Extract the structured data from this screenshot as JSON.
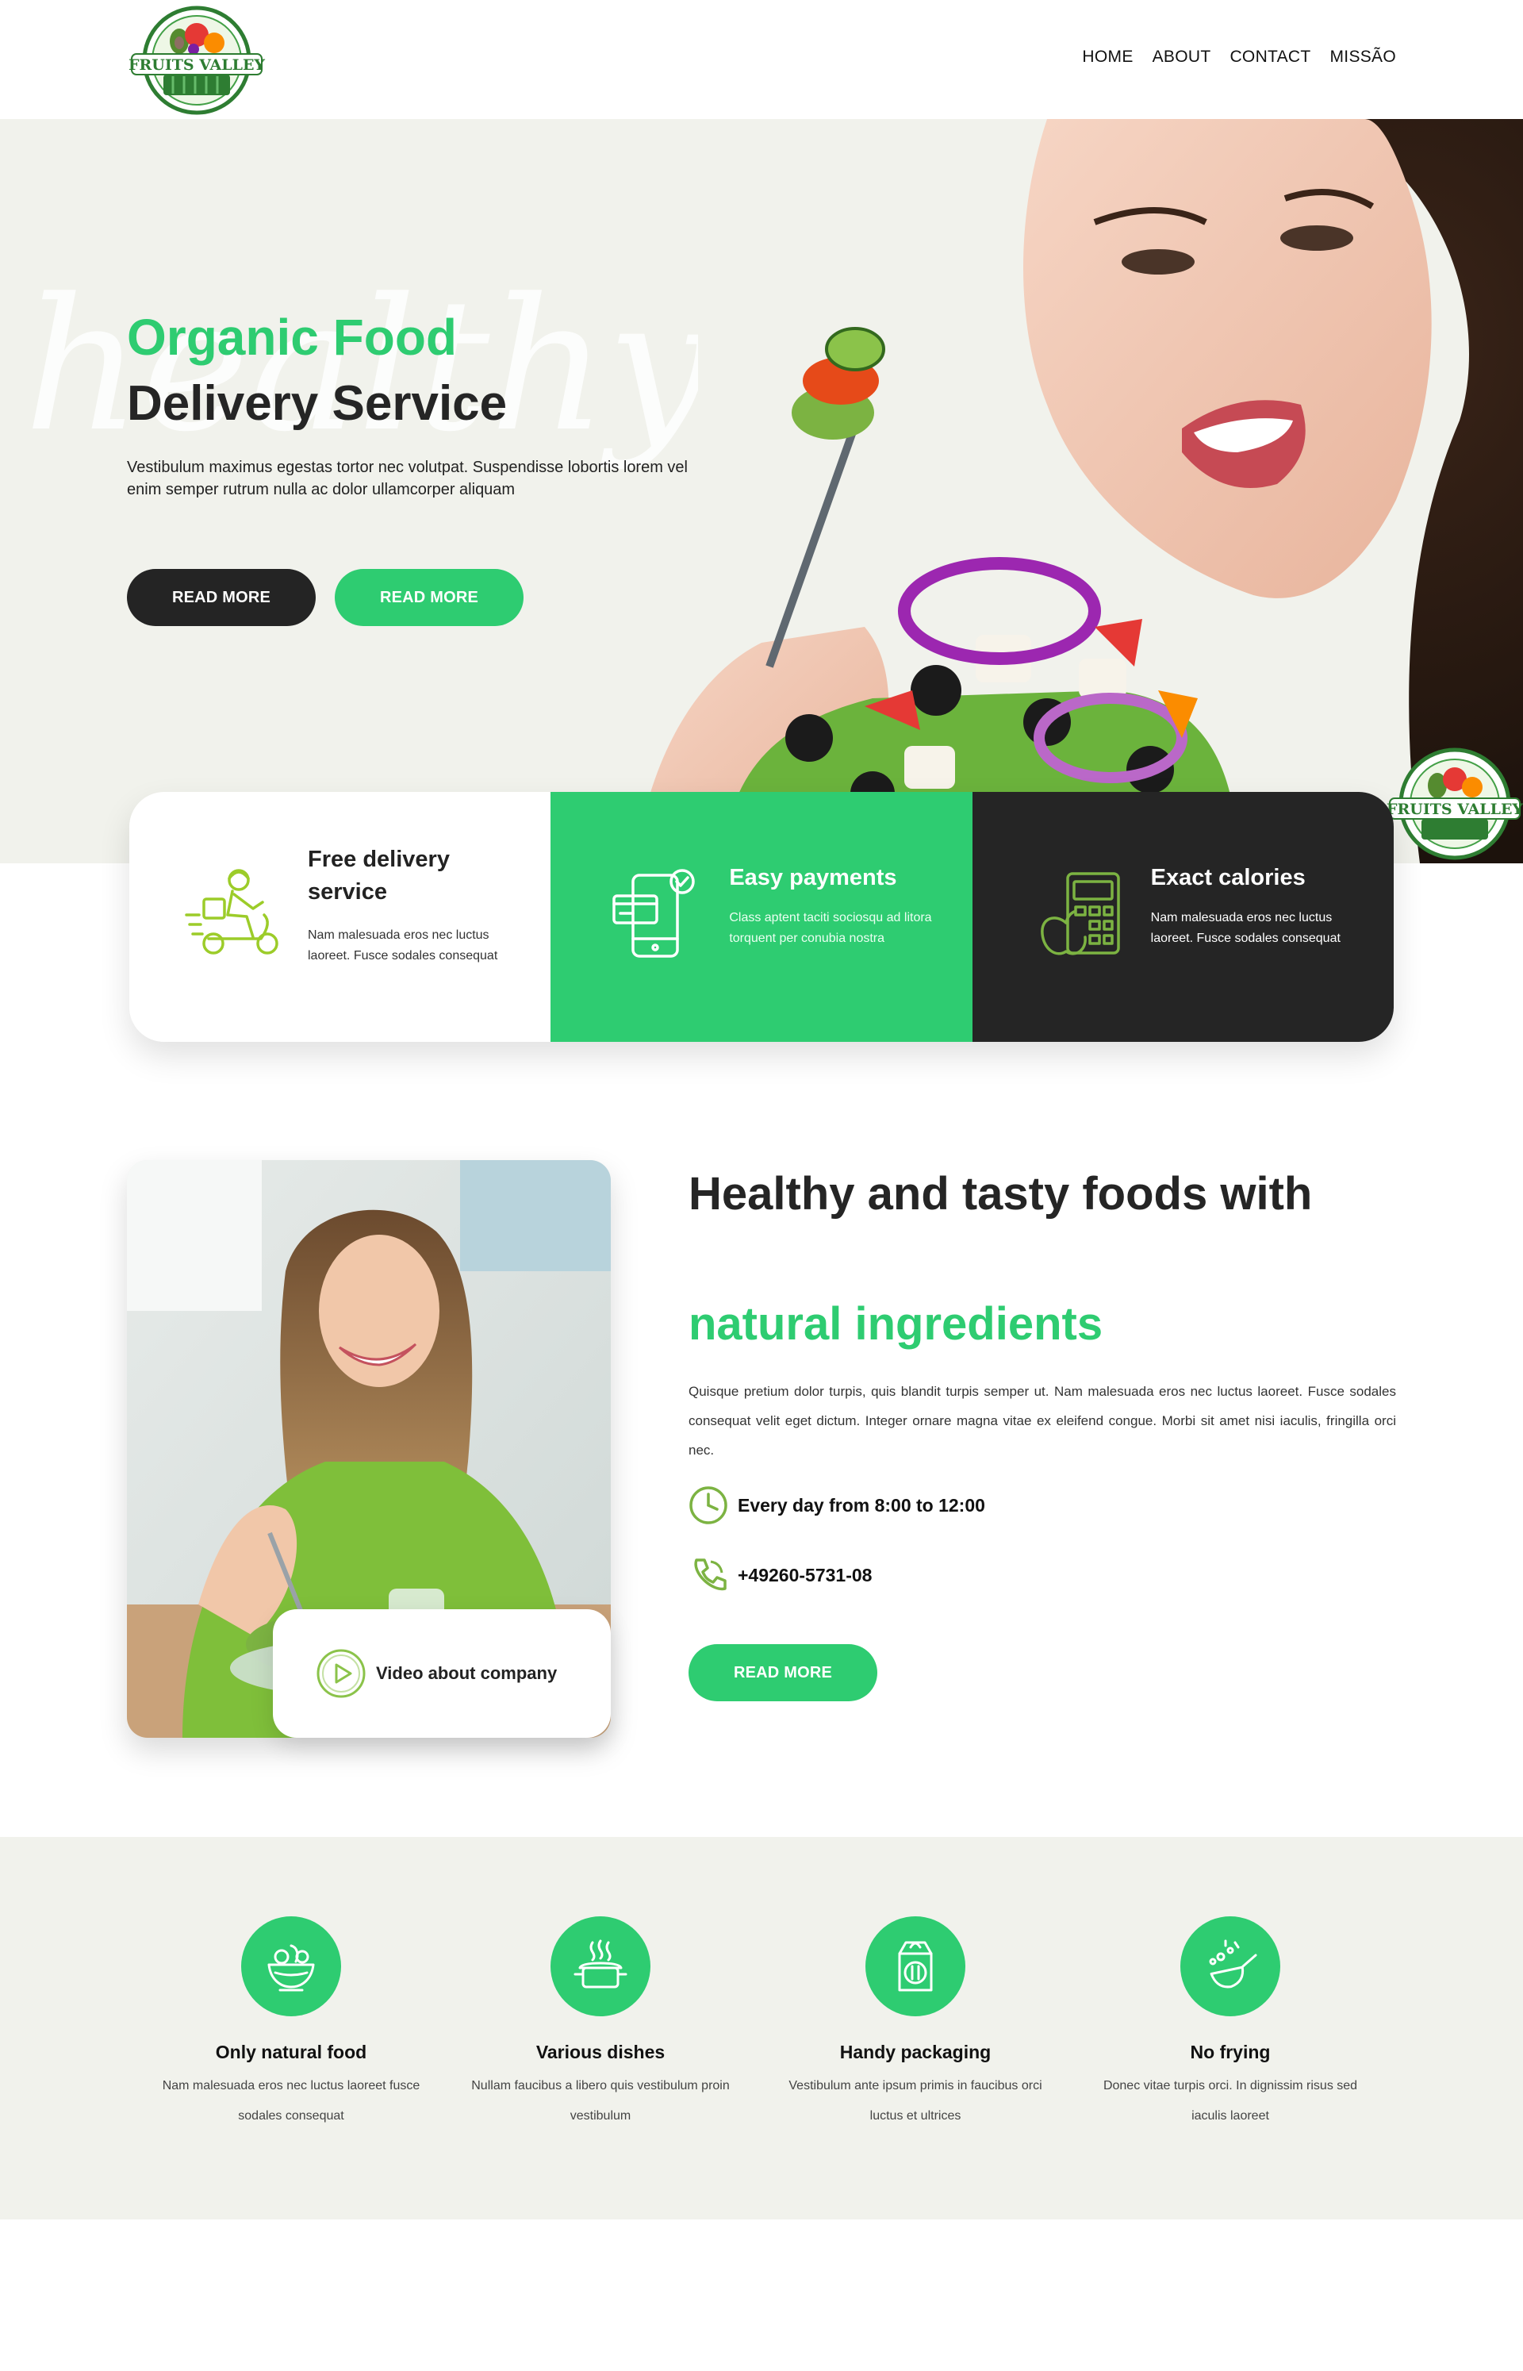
{
  "brand": {
    "logo_text": "FRUITS VALLEY",
    "colors": {
      "green": "#2ecc71",
      "dark": "#252525",
      "cream": "#f1f2ec"
    }
  },
  "nav": {
    "items": [
      "HOME",
      "ABOUT",
      "CONTACT",
      "MISSÃO"
    ]
  },
  "hero": {
    "script_word": "healthy",
    "title_green": "Organic Food",
    "title_dark": "Delivery Service",
    "description": "Vestibulum maximus egestas tortor nec volutpat. Suspendisse lobortis lorem vel enim semper rutrum nulla ac dolor ullamcorper aliquam",
    "button_dark": "READ MORE",
    "button_green": "READ MORE"
  },
  "features": [
    {
      "title": "Free delivery service",
      "text": "Nam malesuada eros nec luctus laoreet. Fusce sodales consequat",
      "icon": "delivery-scooter-icon"
    },
    {
      "title": "Easy payments",
      "text": "Class aptent taciti sociosqu ad litora torquent per conubia nostra",
      "icon": "mobile-payment-icon"
    },
    {
      "title": "Exact calories",
      "text": "Nam malesuada eros nec luctus laoreet. Fusce sodales consequat",
      "icon": "calorie-calculator-icon"
    }
  ],
  "about": {
    "heading_dark": "Healthy and tasty foods with",
    "heading_green": "natural ingredients",
    "description": "Quisque pretium dolor turpis, quis blandit turpis semper ut. Nam malesuada eros nec luctus laoreet. Fusce sodales consequat velit eget dictum. Integer ornare magna vitae ex eleifend congue. Morbi sit amet nisi iaculis, fringilla orci nec.",
    "hours": "Every day from 8:00 to 12:00",
    "phone": "+49260-5731-08",
    "button": "READ MORE",
    "video_label": "Video about company"
  },
  "benefits": [
    {
      "title": "Only natural food",
      "text": "Nam malesuada eros nec luctus laoreet fusce sodales consequat",
      "icon": "salad-bowl-icon"
    },
    {
      "title": "Various dishes",
      "text": "Nullam faucibus a libero quis vestibulum proin vestibulum",
      "icon": "cooking-pot-icon"
    },
    {
      "title": "Handy packaging",
      "text": "Vestibulum ante ipsum primis in faucibus orci luctus et ultrices",
      "icon": "food-package-icon"
    },
    {
      "title": "No frying",
      "text": "Donec vitae turpis orci. In dignissim risus sed iaculis laoreet",
      "icon": "no-frying-pan-icon"
    }
  ]
}
